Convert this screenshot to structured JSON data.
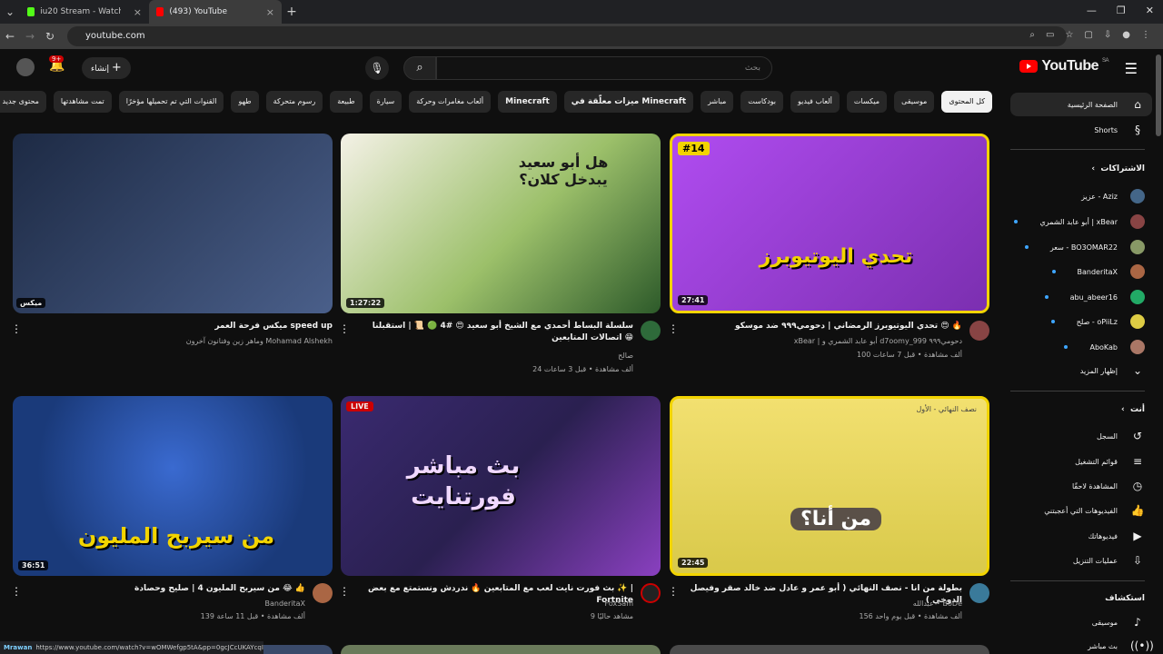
{
  "browser": {
    "tabs": [
      {
        "label": "iu20 Stream - Watch Live on Ki",
        "active": false,
        "color": "#53fc18"
      },
      {
        "label": "(493) YouTube",
        "active": true,
        "color": "#ff0000"
      }
    ],
    "url": "youtube.com",
    "status_url": "https://www.youtube.com/watch?v=wOMWefgp5tA&pp=0gcJCcUKAYcqIYzv",
    "status_overlay": "Mrawan"
  },
  "header": {
    "logo_text": "YouTube",
    "region": "SA",
    "search_placeholder": "بحث",
    "create_label": "إنشاء",
    "notif_count": "9+"
  },
  "chips": [
    "كل المحتوى",
    "موسيقى",
    "ميكسات",
    "ألعاب فيديو",
    "بودكاست",
    "مباشر",
    "ميزات معلّقة في Minecraft",
    "Minecraft",
    "ألعاب مغامرات وحركة",
    "سيارة",
    "طبيعة",
    "رسوم متحركة",
    "طهو",
    "القنوات التي تم تحميلها مؤخرًا",
    "تمت مشاهدتها",
    "محتوى جديد لك"
  ],
  "sidebar": {
    "home": "الصفحة الرئيسية",
    "shorts": "Shorts",
    "subs_header": "الاشتراكات",
    "subscriptions": [
      {
        "name": "عزيز - Aziz",
        "color": "#446688"
      },
      {
        "name": "أبو عابد الشمري | xBear",
        "color": "#884444"
      },
      {
        "name": "سعر - BO3OMAR22",
        "color": "#889966"
      },
      {
        "name": "BanderitaX",
        "color": "#aa6644"
      },
      {
        "name": "abu_abeer16",
        "color": "#22aa66"
      },
      {
        "name": "صلح - oPiiLz",
        "color": "#ddcc44"
      },
      {
        "name": "AboKab",
        "color": "#aa7766"
      }
    ],
    "show_more": "إظهار المزيد",
    "you_header": "أنت",
    "you_items": [
      {
        "label": "السجل",
        "icon": "history-icon"
      },
      {
        "label": "قوائم التشغيل",
        "icon": "playlist-icon"
      },
      {
        "label": "المشاهدة لاحقًا",
        "icon": "clock-icon"
      },
      {
        "label": "الفيديوهات التي أعجبتني",
        "icon": "like-icon"
      },
      {
        "label": "فيديوهاتك",
        "icon": "video-icon"
      },
      {
        "label": "عمليات التنزيل",
        "icon": "download-icon"
      }
    ],
    "explore_header": "استكشاف",
    "explore_items": [
      {
        "label": "موسيقى",
        "icon": "music-icon"
      },
      {
        "label": "بث مباشر",
        "icon": "live-icon"
      }
    ]
  },
  "videos": [
    {
      "title": "ميكس فرحة العمر speed up",
      "channel": "وماهر زين وفنانون آخرون Mohamad Alshekh",
      "stats": "",
      "duration": "",
      "badge": "ميكس",
      "thumb_text": "",
      "thumb_bg": "#1d2a44"
    },
    {
      "title": "سلسلة البساط أحمدي مع الشيخ أبو سعيد 😍 #4 🟢 📜 | استقبلنا اتصالات المتابعين 😁",
      "channel": "صالح",
      "stats": "24 ألف مشاهدة • قبل 3 ساعات",
      "duration": "1:27:22",
      "badge": "",
      "thumb_text": "هل أبو سعيد يبدخل كلان؟",
      "thumb_bg": "#9cc06a"
    },
    {
      "title": "تحدي اليوتيوبرز الرمضاني | دحومي٩٩٩ ضد موسكو 😍 🔥",
      "channel": "xBear | أبو عابد الشمري و d7oomy_999 دحومي٩٩٩",
      "stats": "100 ألف مشاهدة • قبل 7 ساعات",
      "duration": "27:41",
      "badge": "#14",
      "thumb_text": "تحدي اليوتيوبرز",
      "thumb_bg": "#7b2fb0"
    },
    {
      "title": "من سيربح المليون 4 | صليح وحصادة 😂 👍",
      "channel": "BanderitaX",
      "stats": "139 ألف مشاهدة • قبل 11 ساعة",
      "duration": "36:51",
      "badge": "",
      "thumb_text": "من سيربح المليون",
      "thumb_bg": "#1a3a7a"
    },
    {
      "title": "بث فورت نايت لعب مع المتابعين 🔥 ندردش ونستمتع مع بعض ✨ | Fortnite",
      "channel": "FoxSam",
      "stats": "9 مشاهد حاليًا",
      "duration": "",
      "badge": "LIVE",
      "thumb_text": "بث مباشر فورتنايت",
      "thumb_bg": "#2a2050"
    },
    {
      "title": "بطولة من انا - نصف النهائي ( أبو عمر و عادل ضد خالد صقر وفيصل الدوخي )",
      "channel": "عبدالله • BoDe",
      "stats": "156 ألف مشاهدة • قبل يوم واحد",
      "duration": "22:45",
      "badge": "نصف النهائي - الأول",
      "thumb_text": "من أنا؟",
      "thumb_bg": "#d9c94a"
    }
  ],
  "colors": {
    "accent": "#ff0000",
    "bg": "#0f0f0f",
    "chip": "#272727"
  }
}
